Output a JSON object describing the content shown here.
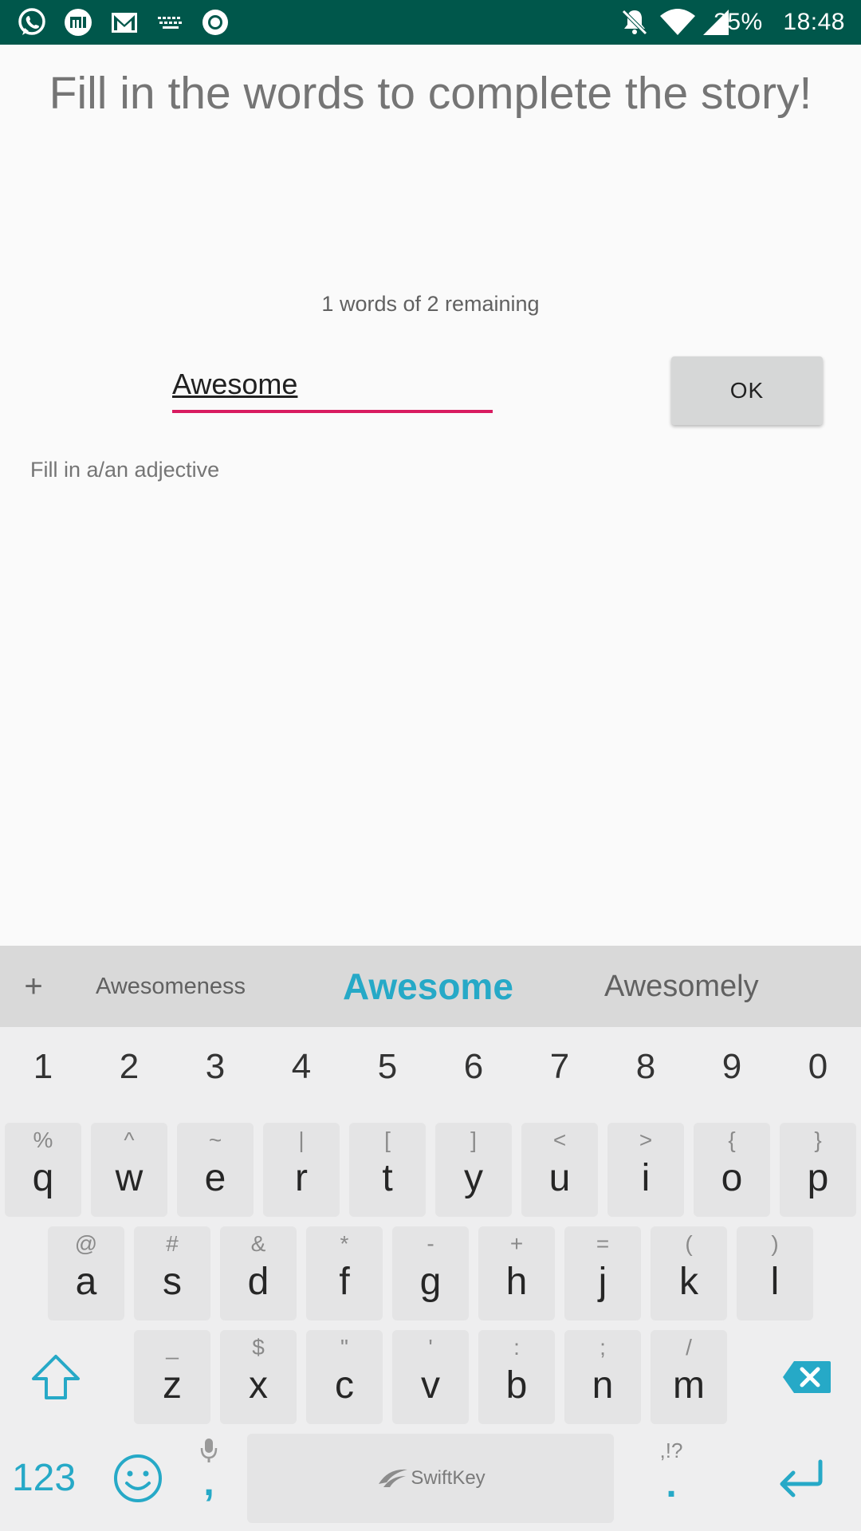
{
  "status_bar": {
    "battery": "35%",
    "time": "18:48",
    "notification_icons": [
      "whatsapp-icon",
      "mi-icon",
      "gmail-icon",
      "keyboard-icon",
      "record-icon"
    ],
    "system_icons": [
      "do-not-disturb-icon",
      "wifi-icon",
      "signal-icon"
    ]
  },
  "main": {
    "title": "Fill in the words to complete the story!",
    "remaining": "1 words of 2 remaining",
    "word_input_value": "Awesome",
    "ok_label": "OK",
    "hint": "Fill in a/an adjective"
  },
  "keyboard": {
    "suggestions": {
      "add": "+",
      "left": "Awesomeness",
      "middle": "Awesome",
      "right": "Awesomely"
    },
    "numbers": [
      "1",
      "2",
      "3",
      "4",
      "5",
      "6",
      "7",
      "8",
      "9",
      "0"
    ],
    "row1": [
      {
        "pri": "q",
        "sec": "%"
      },
      {
        "pri": "w",
        "sec": "^"
      },
      {
        "pri": "e",
        "sec": "~"
      },
      {
        "pri": "r",
        "sec": "|"
      },
      {
        "pri": "t",
        "sec": "["
      },
      {
        "pri": "y",
        "sec": "]"
      },
      {
        "pri": "u",
        "sec": "<"
      },
      {
        "pri": "i",
        "sec": ">"
      },
      {
        "pri": "o",
        "sec": "{"
      },
      {
        "pri": "p",
        "sec": "}"
      }
    ],
    "row2": [
      {
        "pri": "a",
        "sec": "@"
      },
      {
        "pri": "s",
        "sec": "#"
      },
      {
        "pri": "d",
        "sec": "&"
      },
      {
        "pri": "f",
        "sec": "*"
      },
      {
        "pri": "g",
        "sec": "-"
      },
      {
        "pri": "h",
        "sec": "+"
      },
      {
        "pri": "j",
        "sec": "="
      },
      {
        "pri": "k",
        "sec": "("
      },
      {
        "pri": "l",
        "sec": ")"
      }
    ],
    "row3": [
      {
        "pri": "z",
        "sec": "_"
      },
      {
        "pri": "x",
        "sec": "$"
      },
      {
        "pri": "c",
        "sec": "\""
      },
      {
        "pri": "v",
        "sec": "'"
      },
      {
        "pri": "b",
        "sec": ":"
      },
      {
        "pri": "n",
        "sec": ";"
      },
      {
        "pri": "m",
        "sec": "/"
      }
    ],
    "mode_key": "123",
    "comma": ",",
    "period": ".",
    "period_secondary": ",!?",
    "space_brand": "SwiftKey",
    "accent_color": "#26a9c7"
  }
}
